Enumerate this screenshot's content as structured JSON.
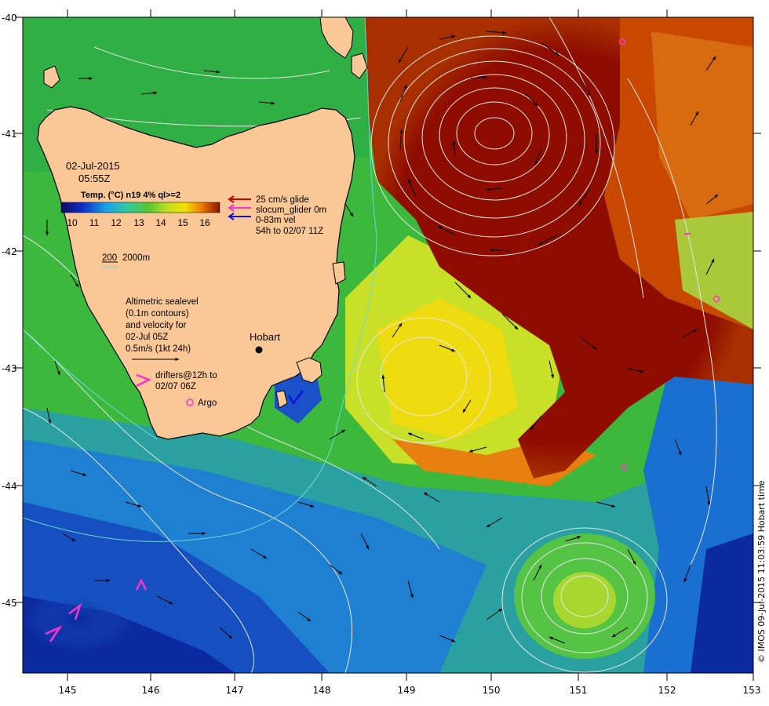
{
  "colors": {
    "land": "#f9c896",
    "coast": "#000000",
    "contour": "#e8e8e8",
    "bathy": "#66dcdc",
    "glide": "#d40000",
    "glider": "#ff33cc",
    "vel": "#1010e0",
    "argo": "#ff33cc",
    "cold": "#0a2aa8",
    "warm": "#8b1000"
  },
  "header": {
    "date": "02-Jul-2015",
    "time": "05:55Z"
  },
  "colorbar": {
    "title": "Temp. (°C) n19 4% ql>=2",
    "ticks": [
      "10",
      "11",
      "12",
      "13",
      "14",
      "15",
      "16"
    ]
  },
  "legend": {
    "glide": "25 cm/s glide",
    "glider": "slocum_glider 0m",
    "vel": "0-83m vel",
    "window": "54h to 02/07 11Z"
  },
  "bathy": {
    "label1": "200",
    "label2": "2000m"
  },
  "altimetry": {
    "line1": "Altimetric sealevel",
    "line2": "(0.1m contours)",
    "line3": "and velocity for",
    "line4": "02-Jul 05Z",
    "line5": "0.5m/s (1kt 24h)"
  },
  "drifters": {
    "line1": "drifters@12h to",
    "line2": "02/07 06Z"
  },
  "argo_label": "Argo",
  "place": "Hobart",
  "credit": "© IMOS 09-Jul-2015 11:03:59 Hobart time",
  "map": {
    "lon_range": [
      144.5,
      153
    ],
    "lat_range": [
      -45.6,
      -40
    ],
    "x_ticks": [
      "145",
      "146",
      "147",
      "148",
      "149",
      "150",
      "151",
      "152",
      "153"
    ],
    "y_ticks": [
      "-40",
      "-41",
      "-42",
      "-43",
      "-44",
      "-45"
    ]
  }
}
